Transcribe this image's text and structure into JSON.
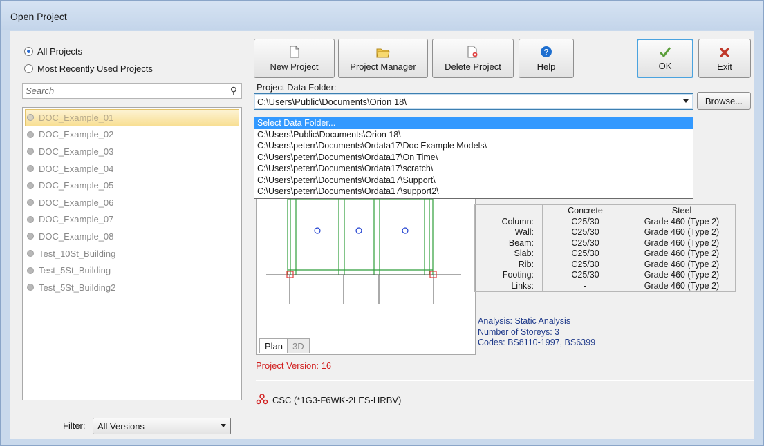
{
  "window": {
    "title": "Open Project"
  },
  "left_panel": {
    "radio_all": "All Projects",
    "radio_recent": "Most Recently Used Projects",
    "search_placeholder": "Search",
    "projects": [
      "DOC_Example_01",
      "DOC_Example_02",
      "DOC_Example_03",
      "DOC_Example_04",
      "DOC_Example_05",
      "DOC_Example_06",
      "DOC_Example_07",
      "DOC_Example_08",
      "Test_10St_Building",
      "Test_5St_Building",
      "Test_5St_Building2"
    ],
    "filter_label": "Filter:",
    "filter_value": "All Versions"
  },
  "toolbar": {
    "new_project": "New Project",
    "project_manager": "Project Manager",
    "delete_project": "Delete Project",
    "help": "Help",
    "ok": "OK",
    "exit": "Exit"
  },
  "folder": {
    "label": "Project Data Folder:",
    "value": "C:\\Users\\Public\\Documents\\Orion 18\\",
    "browse": "Browse...",
    "options": [
      "Select Data Folder...",
      "C:\\Users\\Public\\Documents\\Orion 18\\",
      "C:\\Users\\peterr\\Documents\\Ordata17\\Doc Example Models\\",
      "C:\\Users\\peterr\\Documents\\Ordata17\\On Time\\",
      "C:\\Users\\peterr\\Documents\\Ordata17\\scratch\\",
      "C:\\Users\\peterr\\Documents\\Ordata17\\Support\\",
      "C:\\Users\\peterr\\Documents\\Ordata17\\support2\\"
    ]
  },
  "preview": {
    "tab_plan": "Plan",
    "tab_3d": "3D"
  },
  "materials": {
    "headers": [
      "",
      "Concrete",
      "Steel"
    ],
    "rows": [
      [
        "Column:",
        "C25/30",
        "Grade 460 (Type 2)"
      ],
      [
        "Wall:",
        "C25/30",
        "Grade 460 (Type 2)"
      ],
      [
        "Beam:",
        "C25/30",
        "Grade 460 (Type 2)"
      ],
      [
        "Slab:",
        "C25/30",
        "Grade 460 (Type 2)"
      ],
      [
        "Rib:",
        "C25/30",
        "Grade 460 (Type 2)"
      ],
      [
        "Footing:",
        "C25/30",
        "Grade 460 (Type 2)"
      ],
      [
        "Links:",
        "-",
        "Grade 460 (Type 2)"
      ]
    ]
  },
  "info": {
    "analysis": "Analysis: Static Analysis",
    "storeys": "Number of Storeys: 3",
    "codes": "Codes: BS8110-1997, BS6399"
  },
  "version": "Project Version: 16",
  "license": "CSC (*1G3-F6WK-2LES-HRBV)",
  "colors": {
    "accent": "#3399ff",
    "version_red": "#d11e1e",
    "info_blue": "#1f3a8a",
    "plan_green": "#2e9e3a",
    "plan_red": "#e03c3c"
  }
}
